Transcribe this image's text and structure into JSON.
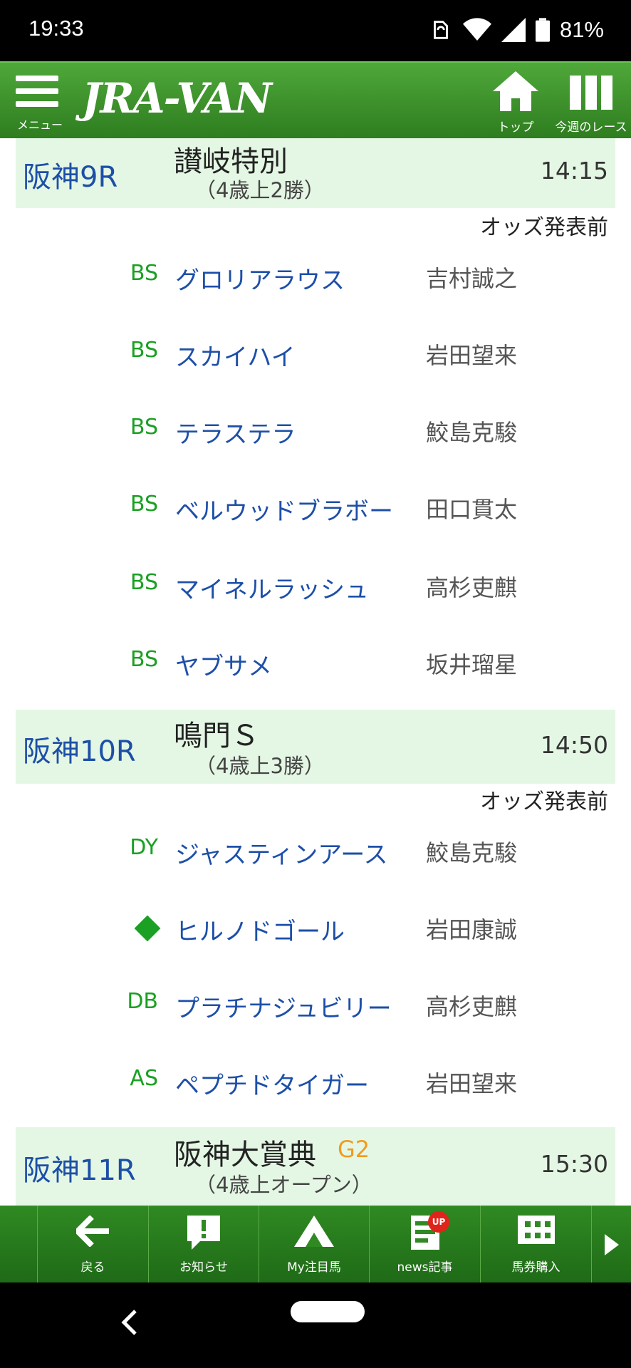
{
  "status_bar": {
    "time": "19:33",
    "battery_percent": "81%"
  },
  "header": {
    "menu_label": "メニュー",
    "logo_text": "JRA-VAN",
    "top_label": "トップ",
    "weekly_races_label": "今週のレース"
  },
  "races": [
    {
      "venue": "阪神9R",
      "name": "讃岐特別",
      "grade": "",
      "condition": "（4歳上2勝）",
      "time": "14:15",
      "odds_status": "オッズ発表前",
      "entries": [
        {
          "mark": "BS",
          "horse": "グロリアラウス",
          "jockey": "吉村誠之"
        },
        {
          "mark": "BS",
          "horse": "スカイハイ",
          "jockey": "岩田望来"
        },
        {
          "mark": "BS",
          "horse": "テラステラ",
          "jockey": "鮫島克駿"
        },
        {
          "mark": "BS",
          "horse": "ベルウッドブラボー",
          "jockey": "田口貫太"
        },
        {
          "mark": "BS",
          "horse": "マイネルラッシュ",
          "jockey": "高杉吏麒"
        },
        {
          "mark": "BS",
          "horse": "ヤブサメ",
          "jockey": "坂井瑠星"
        }
      ]
    },
    {
      "venue": "阪神10R",
      "name": "鳴門Ｓ",
      "grade": "",
      "condition": "（4歳上3勝）",
      "time": "14:50",
      "odds_status": "オッズ発表前",
      "entries": [
        {
          "mark": "DY",
          "horse": "ジャスティンアース",
          "jockey": "鮫島克駿"
        },
        {
          "mark": "◆",
          "horse": "ヒルノドゴール",
          "jockey": "岩田康誠"
        },
        {
          "mark": "DB",
          "horse": "プラチナジュビリー",
          "jockey": "高杉吏麒"
        },
        {
          "mark": "AS",
          "horse": "ペプチドタイガー",
          "jockey": "岩田望来"
        }
      ]
    },
    {
      "venue": "阪神11R",
      "name": "阪神大賞典",
      "grade": "G2",
      "condition": "（4歳上オープン）",
      "time": "15:30"
    }
  ],
  "bottom_nav": {
    "back": "戻る",
    "notices": "お知らせ",
    "my_horses": "My注目馬",
    "news": "news記事",
    "news_badge": "UP",
    "ticket": "馬券購入"
  },
  "icons": {
    "menu": "hamburger-menu-icon",
    "top": "home-icon",
    "weekly": "columns-icon",
    "back": "arrow-left-icon",
    "notices": "exclamation-icon",
    "my_horses": "triangle-icon",
    "news": "document-icon",
    "ticket": "ticket-icon",
    "next": "play-right-icon"
  },
  "colors": {
    "header_green": "#2e7d1f",
    "race_header_bg": "#e4f7e4",
    "venue_blue": "#1d4fa8",
    "mark_green": "#1aa022",
    "grade_orange": "#f39a1e"
  }
}
